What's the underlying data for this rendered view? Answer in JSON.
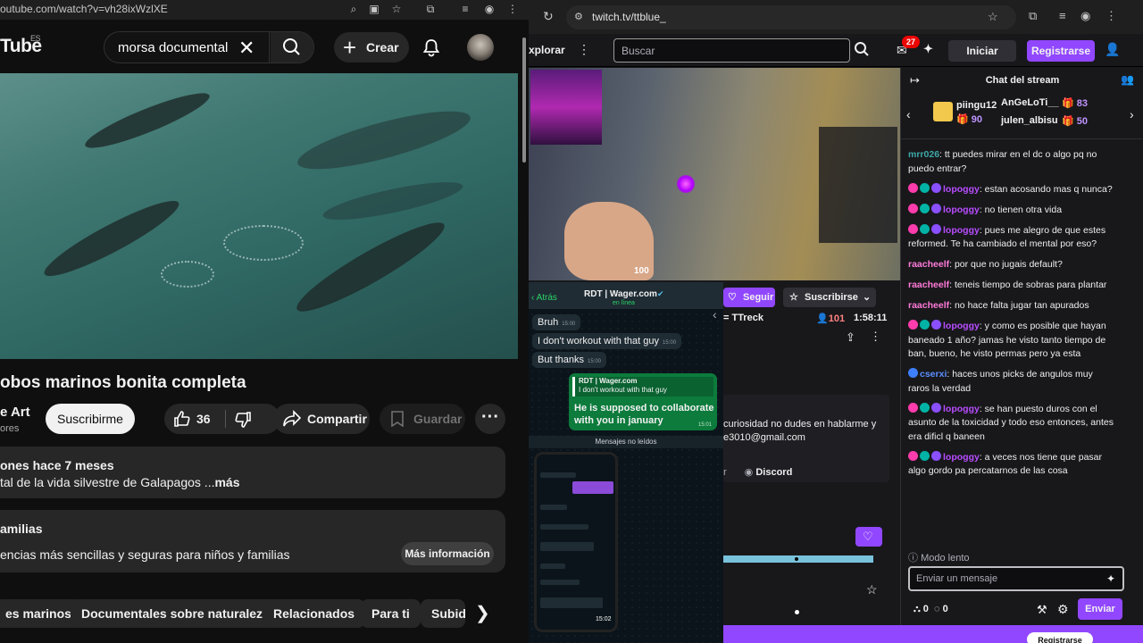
{
  "youtube": {
    "url": "outube.com/watch?v=vh28ixWzlXE",
    "logo": "Tube",
    "region": "ES",
    "search_query": "morsa documental",
    "create_label": "Crear",
    "video_title": "obos marinos bonita completa",
    "channel_name": "e Art",
    "channel_sub": "ores",
    "subscribe_label": "Suscribirme",
    "likes": "36",
    "share_label": "Compartir",
    "save_label": "Guardar",
    "desc_line1": "ones  hace 7 meses",
    "desc_line2": "tal de la vida silvestre de Galapagos ...",
    "desc_more": "más",
    "family_title": "amilias",
    "family_text": "encias más sencillas y seguras para niños y familias",
    "family_button": "Más información",
    "chips": [
      "es marinos",
      "Documentales sobre naturaleza",
      "Relacionados",
      "Para ti",
      "Subid"
    ]
  },
  "twitch": {
    "url": "twitch.tv/ttblue_",
    "explore": "xplorar",
    "search_placeholder": "Buscar",
    "notif_count": "27",
    "login": "Iniciar sesión",
    "register": "Registrarse",
    "hud_health": "100",
    "follow": "Seguir",
    "subscribe": "Suscribirse",
    "streamer_line": "= TTreck",
    "viewers": "101",
    "uptime": "1:58:11",
    "about_text_1": "curiosidad no dudes en hablarme y",
    "about_text_2": "e3010@gmail.com",
    "discord_prefix": "r",
    "discord": "Discord",
    "bottom_button": "Registrarse"
  },
  "whatsapp": {
    "back": "Atrás",
    "contact": "RDT | Wager.com",
    "status": "en línea",
    "msg1": "Bruh",
    "msg1_time": "15:00",
    "msg2": "I don't workout with that guy",
    "msg2_time": "15:00",
    "msg3": "But thanks",
    "msg3_time": "15:00",
    "reply_quote_name": "RDT | Wager.com",
    "reply_quote_text": "I don't workout with that guy",
    "reply_text": "He is supposed to collaborate with you in january",
    "reply_time": "15:01",
    "unread_label": "Mensajes no leídos",
    "phone_time": "15:02"
  },
  "chat": {
    "header": "Chat del stream",
    "gifters": [
      {
        "name": "piingu12",
        "count": "90"
      },
      {
        "name": "AnGeLoTi__",
        "count": "83"
      },
      {
        "name": "julen_albisu",
        "count": "50"
      }
    ],
    "messages": [
      {
        "user": "mrr026",
        "color": "#3ea8a8",
        "text": "tt puedes mirar en el dc o algo pq no puedo entrar?",
        "badges": 0
      },
      {
        "user": "lopoggy",
        "color": "#b84dff",
        "text": "estan acosando mas q nunca?",
        "badges": 3
      },
      {
        "user": "lopoggy",
        "color": "#b84dff",
        "text": "no tienen otra vida",
        "badges": 3
      },
      {
        "user": "lopoggy",
        "color": "#b84dff",
        "text": "pues me alegro de que estes reformed. Te ha cambiado el mental por eso?",
        "badges": 3
      },
      {
        "user": "raacheelf",
        "color": "#ff7ad9",
        "text": "por que no jugais default?",
        "badges": 0
      },
      {
        "user": "raacheelf",
        "color": "#ff7ad9",
        "text": "teneis tiempo de sobras para plantar",
        "badges": 0
      },
      {
        "user": "raacheelf",
        "color": "#ff7ad9",
        "text": "no hace falta jugar tan apurados",
        "badges": 0
      },
      {
        "user": "lopoggy",
        "color": "#b84dff",
        "text": "y como es posible que hayan baneado 1 año? jamas he visto tanto tiempo de ban, bueno, he visto permas pero ya esta",
        "badges": 3
      },
      {
        "user": "cserxi",
        "color": "#5b8fff",
        "text": "haces unos picks de angulos muy raros la verdad",
        "badges": 1
      },
      {
        "user": "lopoggy",
        "color": "#b84dff",
        "text": "se han puesto duros con el asunto de la toxicidad y todo eso entonces, antes era dificl q baneen",
        "badges": 3
      },
      {
        "user": "lopoggy",
        "color": "#b84dff",
        "text": "a veces nos tiene que pasar algo gordo pa percatarnos de las cosa",
        "badges": 3
      }
    ],
    "slow_mode": "Modo lento",
    "input_placeholder": "Enviar un mensaje",
    "points_a": "0",
    "points_b": "0",
    "send": "Enviar"
  },
  "colors": {
    "twitch_purple": "#9147ff",
    "whatsapp_green": "#0c7b3c",
    "youtube_bg": "#0f0f0f"
  }
}
